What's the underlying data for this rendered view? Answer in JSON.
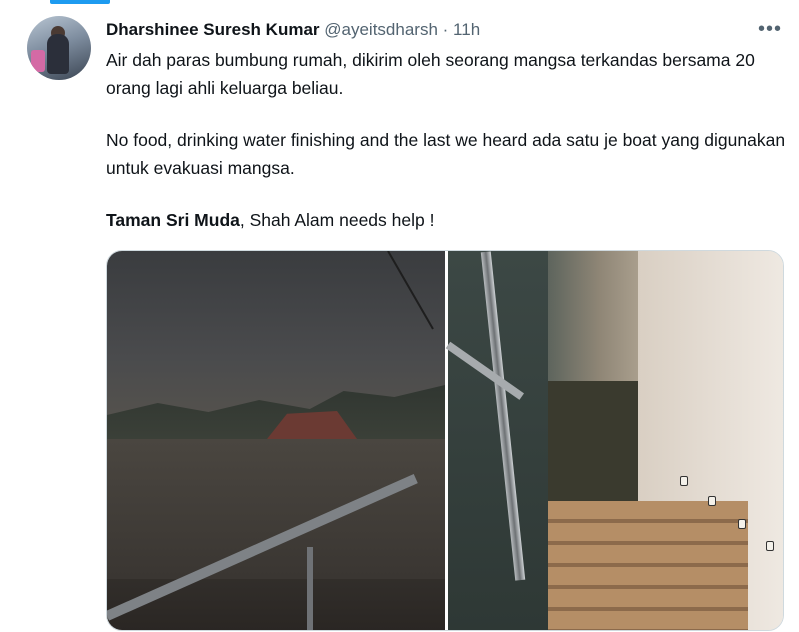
{
  "tweet": {
    "author_name": "Dharshinee Suresh Kumar",
    "handle": "@ayeitsdharsh",
    "separator": "·",
    "time": "11h",
    "more_icon": "more-options-icon",
    "paragraph1": "Air dah paras bumbung rumah, dikirim oleh seorang mangsa terkandas bersama 20 orang lagi ahli keluarga beliau.",
    "paragraph2": "No food, drinking water finishing and the last we heard ada satu je boat yang digunakan untuk evakuasi mangsa.",
    "paragraph3_bold": "Taman Sri Muda",
    "paragraph3_rest": ", Shah Alam needs help !"
  },
  "colors": {
    "accent": "#1d9bf0",
    "text": "#0f1419",
    "secondary_text": "#536471"
  }
}
